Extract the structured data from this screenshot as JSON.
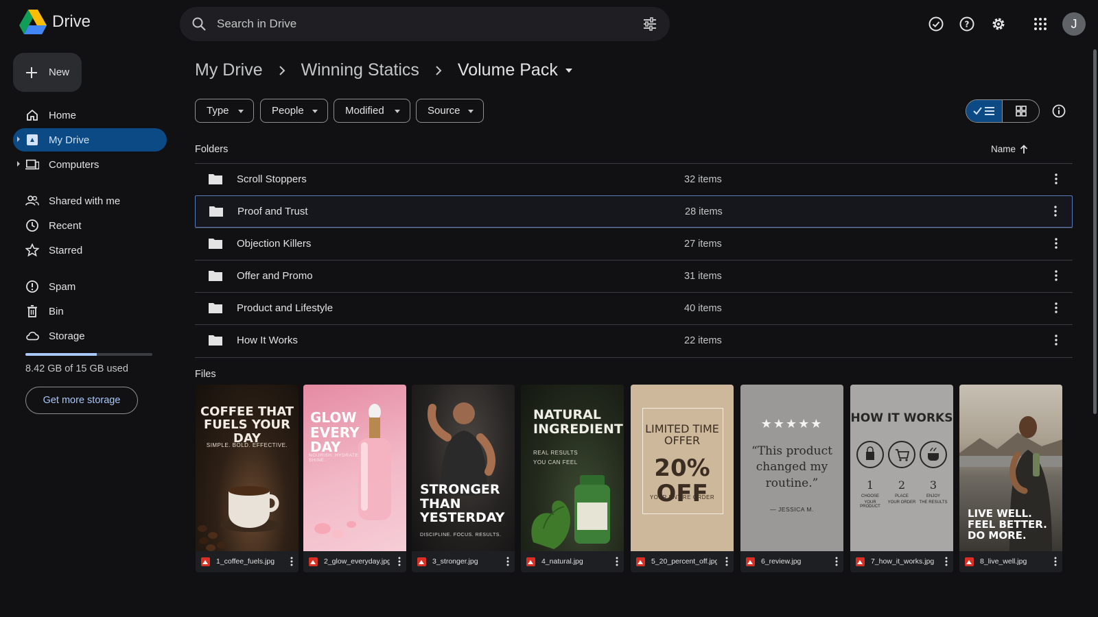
{
  "app": {
    "name": "Drive"
  },
  "search": {
    "placeholder": "Search in Drive"
  },
  "user": {
    "initial": "J"
  },
  "sidebar": {
    "new_label": "New",
    "items": [
      {
        "label": "Home",
        "icon": "home-icon"
      },
      {
        "label": "My Drive",
        "icon": "drive-icon",
        "active": true
      },
      {
        "label": "Computers",
        "icon": "computer-icon"
      },
      {
        "label": "Shared with me",
        "icon": "people-icon"
      },
      {
        "label": "Recent",
        "icon": "clock-icon"
      },
      {
        "label": "Starred",
        "icon": "star-icon"
      },
      {
        "label": "Spam",
        "icon": "spam-icon"
      },
      {
        "label": "Bin",
        "icon": "trash-icon"
      },
      {
        "label": "Storage",
        "icon": "cloud-icon"
      }
    ],
    "storage": {
      "used_text": "8.42 GB of 15 GB used",
      "fraction": 0.56,
      "cta": "Get more storage"
    }
  },
  "breadcrumb": [
    "My Drive",
    "Winning Statics",
    "Volume Pack"
  ],
  "filters": [
    "Type",
    "People",
    "Modified",
    "Source"
  ],
  "sections": {
    "folders": "Folders",
    "files": "Files",
    "sort_label": "Name"
  },
  "folders": [
    {
      "name": "Scroll Stoppers",
      "count": "32 items"
    },
    {
      "name": "Proof and Trust",
      "count": "28 items",
      "selected": true
    },
    {
      "name": "Objection Killers",
      "count": "27 items"
    },
    {
      "name": "Offer and Promo",
      "count": "31 items"
    },
    {
      "name": "Product and Lifestyle",
      "count": "40 items"
    },
    {
      "name": "How It Works",
      "count": "22 items"
    }
  ],
  "files": [
    {
      "name": "1_coffee_fuels.jpg",
      "headline": [
        "COFFEE THAT",
        "FUELS YOUR DAY"
      ],
      "sub": "SIMPLE. BOLD. EFFECTIVE."
    },
    {
      "name": "2_glow_everyday.jpg",
      "headline": [
        "GLOW",
        "EVERY DAY"
      ],
      "sub": "NOURISH. HYDRATE. SHINE."
    },
    {
      "name": "3_stronger.jpg",
      "headline": [
        "STRONGER",
        "THAN",
        "YESTERDAY"
      ],
      "sub": "DISCIPLINE. FOCUS. RESULTS."
    },
    {
      "name": "4_natural.jpg",
      "headline": [
        "NATURAL",
        "INGREDIENTS"
      ],
      "sub": [
        "REAL RESULTS",
        "YOU CAN FEEL"
      ]
    },
    {
      "name": "5_20_percent_off.jpg",
      "headline": [
        "LIMITED TIME",
        "OFFER"
      ],
      "big": "20% OFF",
      "sub": "YOUR ENTIRE ORDER"
    },
    {
      "name": "6_review.jpg",
      "stars": "★★★★★",
      "quote": [
        "“This product",
        "changed my",
        "routine.”"
      ],
      "sub": "— JESSICA M."
    },
    {
      "name": "7_how_it_works.jpg",
      "headline": [
        "HOW IT WORKS"
      ],
      "steps": [
        {
          "n": "1",
          "l1": "CHOOSE",
          "l2": "YOUR PRODUCT"
        },
        {
          "n": "2",
          "l1": "PLACE",
          "l2": "YOUR ORDER"
        },
        {
          "n": "3",
          "l1": "ENJOY",
          "l2": "THE RESULTS"
        }
      ]
    },
    {
      "name": "8_live_well.jpg",
      "headline": [
        "LIVE WELL.",
        "FEEL BETTER.",
        "DO MORE."
      ]
    }
  ]
}
